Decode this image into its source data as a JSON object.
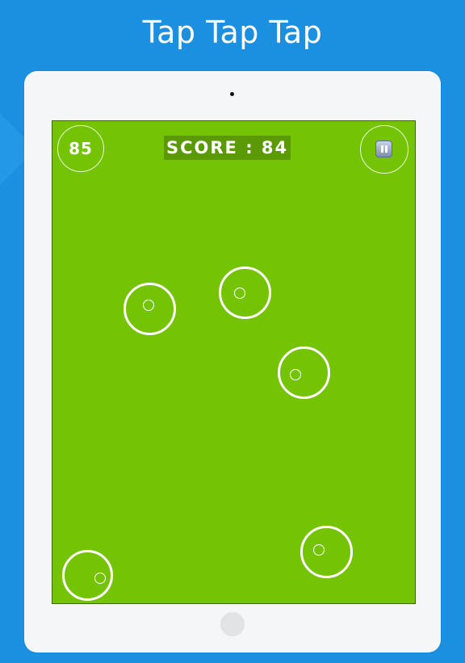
{
  "header": {
    "title": "Tap Tap Tap"
  },
  "game": {
    "round_counter": "85",
    "score_text": "SCORE : 84",
    "pause_icon": "pause-icon",
    "colors": {
      "background": "#1b8fe0",
      "playfield": "#74c305",
      "score_badge": "#5b9a06",
      "ring": "#ffffff"
    }
  }
}
